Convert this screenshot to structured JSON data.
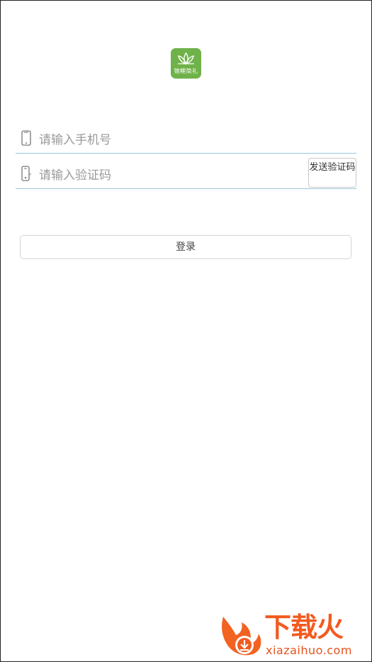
{
  "logo": {
    "text": "锦鲤简礼",
    "color": "#6fb24a"
  },
  "phone": {
    "placeholder": "请输入手机号",
    "icon": "phone-icon"
  },
  "code": {
    "placeholder": "请输入验证码",
    "icon": "phone-lock-icon"
  },
  "send_code_label": "发送验证码",
  "login_label": "登录",
  "watermark": {
    "cn": "下载火",
    "url": "xiazaihuo.com"
  }
}
